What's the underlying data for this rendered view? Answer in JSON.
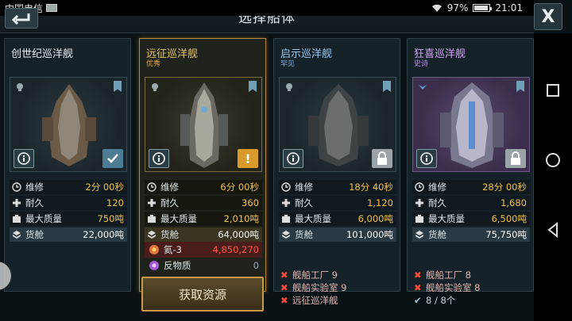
{
  "status_bar": {
    "carrier": "中国电信",
    "battery": "97%",
    "time": "21:01"
  },
  "header": {
    "title": "选择船体",
    "close_label": "X"
  },
  "labels": {
    "maintenance": "维修",
    "durability": "耐久",
    "max_mass": "最大质量",
    "cargo": "货舱",
    "acquire": "获取资源"
  },
  "colors": {
    "gold_value": "#f0c24a",
    "rare_blue": "#7fb6e6",
    "epic_purple": "#c08cf0",
    "uncommon_gold": "#e0a640",
    "error_red": "#ff4a3a"
  },
  "cards": [
    {
      "name": "创世纪巡洋舰",
      "rarity": "",
      "status_icon": "check-icon",
      "stats": {
        "maintenance": "2分 00秒",
        "durability": "120",
        "max_mass": "750吨",
        "cargo": "22,000吨"
      }
    },
    {
      "name": "远征巡洋舰",
      "rarity": "优秀",
      "status_icon": "alert-icon",
      "status_text": "!",
      "stats": {
        "maintenance": "6分 00秒",
        "durability": "360",
        "max_mass": "2,010吨",
        "cargo": "64,000吨"
      },
      "resources": [
        {
          "name": "氦-3",
          "value": "4,850,270",
          "icon": "helium-icon"
        },
        {
          "name": "反物质",
          "value": "0",
          "icon": "antimatter-icon"
        }
      ]
    },
    {
      "name": "启示巡洋舰",
      "rarity": "罕见",
      "status_icon": "lock-icon",
      "stats": {
        "maintenance": "18分 40秒",
        "durability": "1,120",
        "max_mass": "6,000吨",
        "cargo": "101,000吨"
      },
      "requirements": [
        {
          "text": "舰船工厂 9",
          "met": false
        },
        {
          "text": "舰船实验室 9",
          "met": false
        },
        {
          "text": "远征巡洋舰",
          "met": false
        }
      ]
    },
    {
      "name": "狂喜巡洋舰",
      "rarity": "史诗",
      "status_icon": "lock-icon",
      "stats": {
        "maintenance": "28分 00秒",
        "durability": "1,680",
        "max_mass": "6,500吨",
        "cargo": "75,750吨"
      },
      "requirements": [
        {
          "text": "舰船工厂 8",
          "met": false
        },
        {
          "text": "舰船实验室 8",
          "met": false
        },
        {
          "text": "8 / 8个",
          "met": true
        }
      ]
    }
  ]
}
